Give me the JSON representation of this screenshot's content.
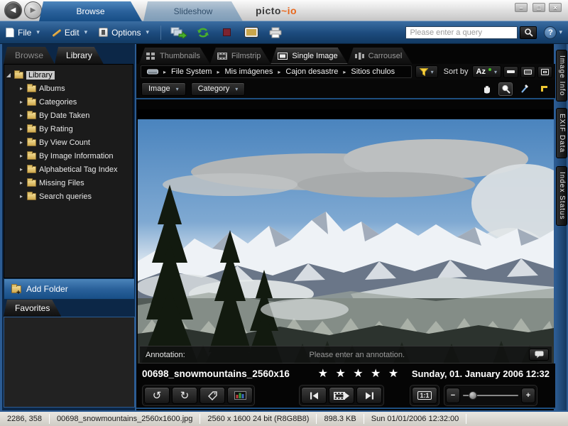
{
  "colors": {
    "accent_orange": "#e8671c",
    "frame_blue": "#2c5c93",
    "folder_tan": "#e3c06a",
    "star_white": "#ffffff"
  },
  "icons": {
    "back": "◀",
    "forward": "▶",
    "dropdown": "▾",
    "crumb_sep": "▸",
    "tree_expanded": "◢",
    "tree_collapsed": "▸",
    "rotate_left": "↺",
    "rotate_right": "↻",
    "minimize": "–",
    "maximize": "□",
    "close": "×",
    "help": "?",
    "add_plus": "+"
  },
  "titlebar": {
    "tabs": [
      {
        "label": "Browse"
      },
      {
        "label": "Slideshow"
      }
    ],
    "logo_picto": "picto",
    "logo_squiggle": "~",
    "logo_mio": "io"
  },
  "menubar": {
    "file": "File",
    "edit": "Edit",
    "options": "Options",
    "search_placeholder": "Please enter a query"
  },
  "sidebar": {
    "tabs": [
      {
        "label": "Browse"
      },
      {
        "label": "Library"
      }
    ],
    "root": "Library",
    "items": [
      "Albums",
      "Categories",
      "By Date Taken",
      "By Rating",
      "By View Count",
      "By Image Information",
      "Alphabetical Tag Index",
      "Missing Files",
      "Search queries"
    ],
    "add_folder": "Add Folder",
    "favorites": "Favorites"
  },
  "viewbar": {
    "tabs": [
      "Thumbnails",
      "Filmstrip",
      "Single Image",
      "Carrousel"
    ]
  },
  "breadcrumb": {
    "crumbs": [
      "File System",
      "Mis imágenes",
      "Cajon desastre",
      "Sitios chulos"
    ]
  },
  "sortbar": {
    "label": "Sort by",
    "value": "Az"
  },
  "imagebar": {
    "image": "Image",
    "category": "Category"
  },
  "right_panel_tabs": [
    "Image Info",
    "EXIF Data",
    "Index Status"
  ],
  "annotation": {
    "label": "Annotation:",
    "placeholder": "Please enter an annotation."
  },
  "photo_info": {
    "filename": "00698_snowmountains_2560x16",
    "stars": "★ ★ ★ ★ ★",
    "rating": 5,
    "date": "Sunday, 01. January 2006 12:32"
  },
  "zoombar": {
    "ratio": "1:1",
    "minus": "−",
    "plus": "+"
  },
  "statusbar": {
    "coords": "2286, 358",
    "filename": "00698_snowmountains_2560x1600.jpg",
    "format": "2560 x 1600 24 bit (R8G8B8)",
    "size": "898.3 KB",
    "datetime": "Sun 01/01/2006 12:32:00"
  }
}
